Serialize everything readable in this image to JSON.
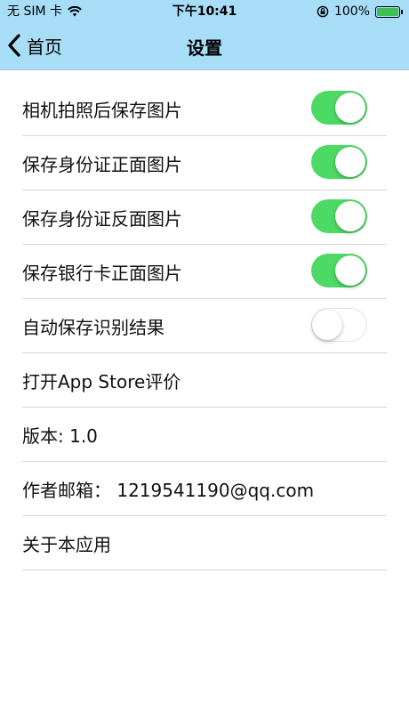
{
  "status": {
    "carrier": "无 SIM 卡",
    "time": "下午10:41",
    "battery": "100%",
    "battery_level": 1.0,
    "battery_color": "#3fbf4f"
  },
  "nav": {
    "back_label": "首页",
    "title": "设置",
    "background_color": "#a8ddf8"
  },
  "settings": [
    {
      "label": "相机拍照后保存图片",
      "toggle": true
    },
    {
      "label": "保存身份证正面图片",
      "toggle": true
    },
    {
      "label": "保存身份证反面图片",
      "toggle": true
    },
    {
      "label": "保存银行卡正面图片",
      "toggle": true
    },
    {
      "label": "自动保存识别结果",
      "toggle": false
    },
    {
      "label": "打开App Store评价"
    },
    {
      "label": "版本: 1.0"
    },
    {
      "label": "作者邮箱： 1219541190@qq.com"
    },
    {
      "label": "关于本应用"
    }
  ],
  "colors": {
    "toggle_on": "#4cd964",
    "separator": "#d6d6d6"
  }
}
